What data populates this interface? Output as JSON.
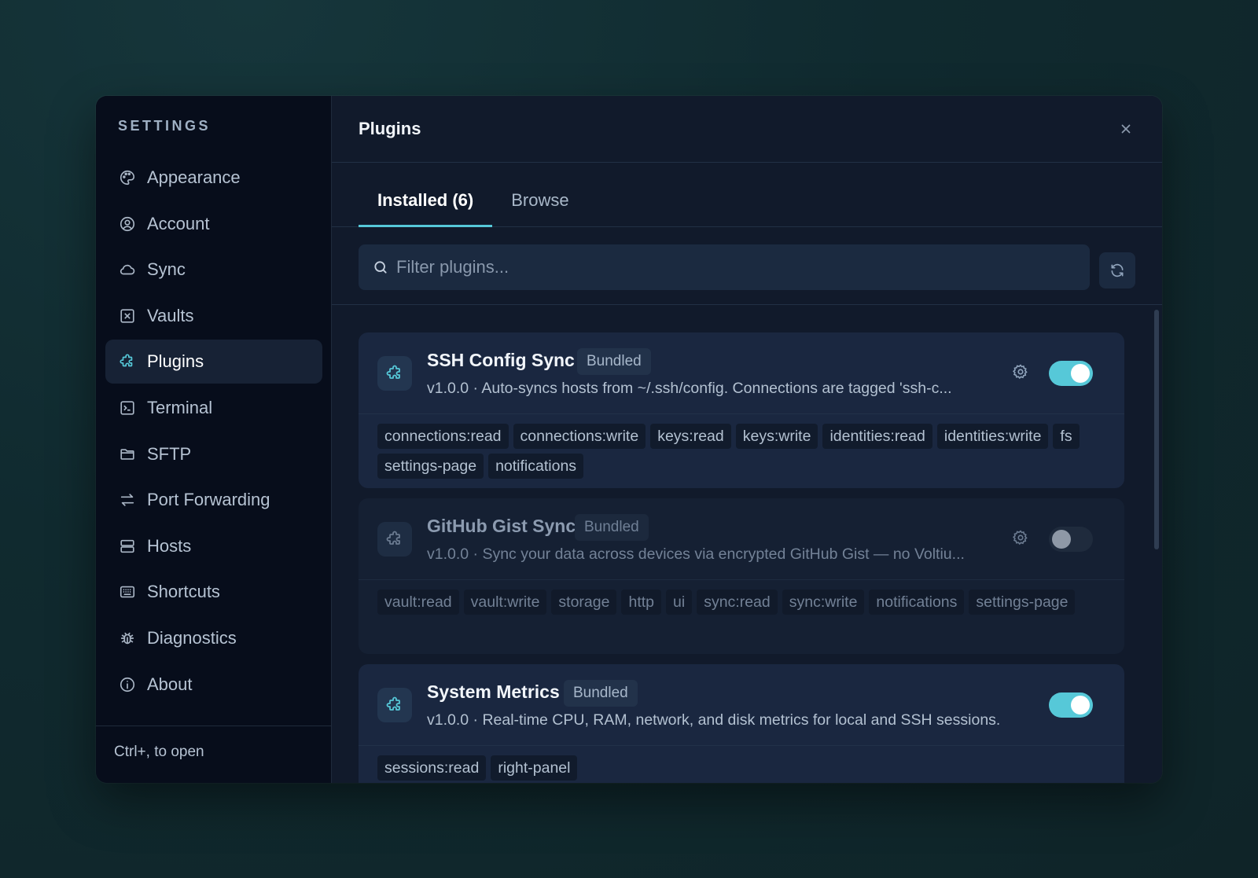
{
  "sidebar": {
    "title": "SETTINGS",
    "items": [
      {
        "label": "Appearance",
        "icon": "palette-icon"
      },
      {
        "label": "Account",
        "icon": "user-circle-icon"
      },
      {
        "label": "Sync",
        "icon": "cloud-icon"
      },
      {
        "label": "Vaults",
        "icon": "vault-icon"
      },
      {
        "label": "Plugins",
        "icon": "puzzle-icon",
        "active": true
      },
      {
        "label": "Terminal",
        "icon": "terminal-icon"
      },
      {
        "label": "SFTP",
        "icon": "folder-icon"
      },
      {
        "label": "Port Forwarding",
        "icon": "arrows-left-right-icon"
      },
      {
        "label": "Hosts",
        "icon": "server-icon"
      },
      {
        "label": "Shortcuts",
        "icon": "keyboard-icon"
      },
      {
        "label": "Diagnostics",
        "icon": "bug-icon"
      },
      {
        "label": "About",
        "icon": "info-icon"
      }
    ],
    "footer": "Ctrl+, to open"
  },
  "header": {
    "title": "Plugins",
    "close_icon": "close-icon"
  },
  "tabs": [
    {
      "label": "Installed (6)",
      "active": true
    },
    {
      "label": "Browse",
      "active": false
    }
  ],
  "search": {
    "placeholder": "Filter plugins...",
    "value": ""
  },
  "colors": {
    "accent": "#56c8d8",
    "sidebar_bg": "#070d1b",
    "panel_bg": "#111a2b",
    "card_bg": "#1a2740"
  },
  "plugins": [
    {
      "name": "SSH Config Sync",
      "badge": "Bundled",
      "description": "v1.0.0 · Auto-syncs hosts from ~/.ssh/config. Connections are tagged 'ssh-c...",
      "enabled": true,
      "has_settings": true,
      "permissions": [
        "connections:read",
        "connections:write",
        "keys:read",
        "keys:write",
        "identities:read",
        "identities:write",
        "fs",
        "settings-page",
        "notifications"
      ]
    },
    {
      "name": "GitHub Gist Sync",
      "badge": "Bundled",
      "description": "v1.0.0 · Sync your data across devices via encrypted GitHub Gist — no Voltiu...",
      "enabled": false,
      "has_settings": true,
      "permissions": [
        "vault:read",
        "vault:write",
        "storage",
        "http",
        "ui",
        "sync:read",
        "sync:write",
        "notifications",
        "settings-page"
      ]
    },
    {
      "name": "System Metrics",
      "badge": "Bundled",
      "description": "v1.0.0 · Real-time CPU, RAM, network, and disk metrics for local and SSH sessions.",
      "enabled": true,
      "has_settings": false,
      "permissions": [
        "sessions:read",
        "right-panel"
      ]
    }
  ]
}
